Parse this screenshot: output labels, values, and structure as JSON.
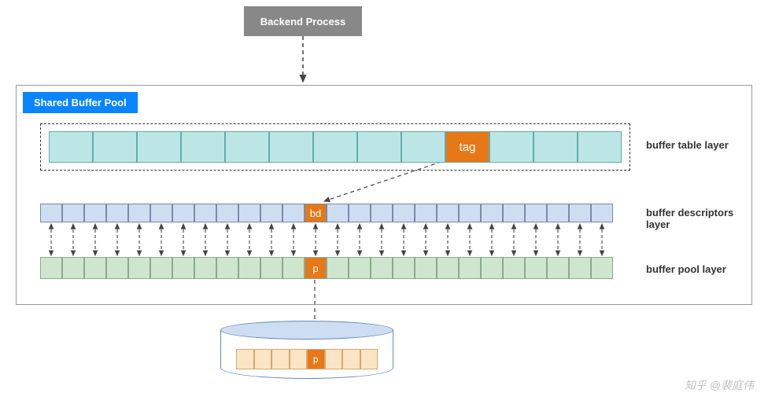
{
  "backend": {
    "label": "Backend Process"
  },
  "pool": {
    "title": "Shared Buffer Pool"
  },
  "labels": {
    "table": "buffer table layer",
    "descriptors": "buffer descriptors layer",
    "pool": "buffer pool layer"
  },
  "cells": {
    "tag": "tag",
    "bd": "bd",
    "p": "p",
    "disk_p": "p"
  },
  "counts": {
    "table_cells": 13,
    "tag_index": 9,
    "desc_cells": 26,
    "bd_index": 12,
    "pool_cells": 26,
    "p_index": 12,
    "disk_cells": 8,
    "disk_p_index": 4
  },
  "colors": {
    "backend_bg": "#888888",
    "pool_label_bg": "#0a84ff",
    "table_cell": "#bce6e6",
    "highlight": "#e67817",
    "desc_cell": "#cdddf2",
    "pool_cell": "#cde6cd",
    "disk_cell": "#fce4c4"
  },
  "watermark": "知乎 @裴庭伟"
}
